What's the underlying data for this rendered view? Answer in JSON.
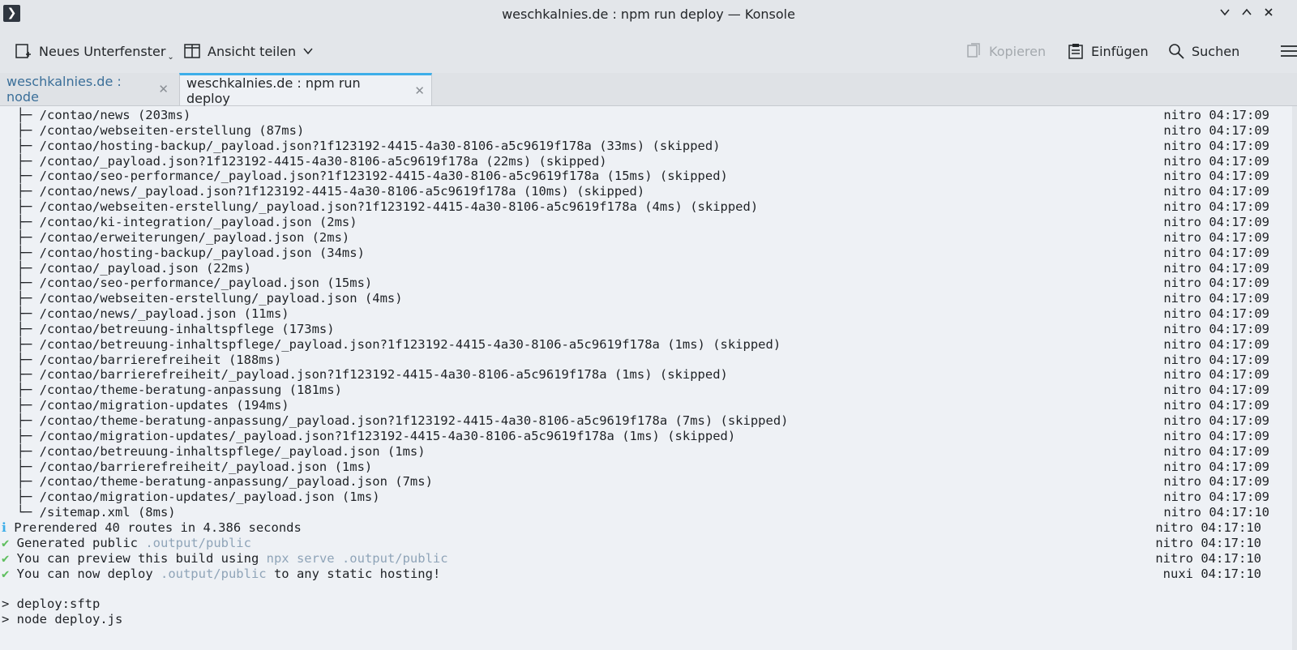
{
  "window": {
    "title": "weschkalnies.de : npm run deploy — Konsole",
    "controls": [
      "minimize",
      "maximize",
      "close"
    ]
  },
  "toolbar": {
    "new_split": "Neues Unterfenster",
    "split_view": "Ansicht teilen",
    "copy": "Kopieren",
    "paste": "Einfügen",
    "search": "Suchen"
  },
  "tabs": [
    {
      "label": "weschkalnies.de : node",
      "active": false
    },
    {
      "label": "weschkalnies.de : npm run deploy",
      "active": true
    }
  ],
  "terminal": {
    "routes": [
      {
        "path": "├─ /contao/news (203ms)",
        "tag": "nitro 04:17:09"
      },
      {
        "path": "├─ /contao/webseiten-erstellung (87ms)",
        "tag": "nitro 04:17:09"
      },
      {
        "path": "├─ /contao/hosting-backup/_payload.json?1f123192-4415-4a30-8106-a5c9619f178a (33ms) (skipped)",
        "tag": "nitro 04:17:09"
      },
      {
        "path": "├─ /contao/_payload.json?1f123192-4415-4a30-8106-a5c9619f178a (22ms) (skipped)",
        "tag": "nitro 04:17:09"
      },
      {
        "path": "├─ /contao/seo-performance/_payload.json?1f123192-4415-4a30-8106-a5c9619f178a (15ms) (skipped)",
        "tag": "nitro 04:17:09"
      },
      {
        "path": "├─ /contao/news/_payload.json?1f123192-4415-4a30-8106-a5c9619f178a (10ms) (skipped)",
        "tag": "nitro 04:17:09"
      },
      {
        "path": "├─ /contao/webseiten-erstellung/_payload.json?1f123192-4415-4a30-8106-a5c9619f178a (4ms) (skipped)",
        "tag": "nitro 04:17:09"
      },
      {
        "path": "├─ /contao/ki-integration/_payload.json (2ms)",
        "tag": "nitro 04:17:09"
      },
      {
        "path": "├─ /contao/erweiterungen/_payload.json (2ms)",
        "tag": "nitro 04:17:09"
      },
      {
        "path": "├─ /contao/hosting-backup/_payload.json (34ms)",
        "tag": "nitro 04:17:09"
      },
      {
        "path": "├─ /contao/_payload.json (22ms)",
        "tag": "nitro 04:17:09"
      },
      {
        "path": "├─ /contao/seo-performance/_payload.json (15ms)",
        "tag": "nitro 04:17:09"
      },
      {
        "path": "├─ /contao/webseiten-erstellung/_payload.json (4ms)",
        "tag": "nitro 04:17:09"
      },
      {
        "path": "├─ /contao/news/_payload.json (11ms)",
        "tag": "nitro 04:17:09"
      },
      {
        "path": "├─ /contao/betreuung-inhaltspflege (173ms)",
        "tag": "nitro 04:17:09"
      },
      {
        "path": "├─ /contao/betreuung-inhaltspflege/_payload.json?1f123192-4415-4a30-8106-a5c9619f178a (1ms) (skipped)",
        "tag": "nitro 04:17:09"
      },
      {
        "path": "├─ /contao/barrierefreiheit (188ms)",
        "tag": "nitro 04:17:09"
      },
      {
        "path": "├─ /contao/barrierefreiheit/_payload.json?1f123192-4415-4a30-8106-a5c9619f178a (1ms) (skipped)",
        "tag": "nitro 04:17:09"
      },
      {
        "path": "├─ /contao/theme-beratung-anpassung (181ms)",
        "tag": "nitro 04:17:09"
      },
      {
        "path": "├─ /contao/migration-updates (194ms)",
        "tag": "nitro 04:17:09"
      },
      {
        "path": "├─ /contao/theme-beratung-anpassung/_payload.json?1f123192-4415-4a30-8106-a5c9619f178a (7ms) (skipped)",
        "tag": "nitro 04:17:09"
      },
      {
        "path": "├─ /contao/migration-updates/_payload.json?1f123192-4415-4a30-8106-a5c9619f178a (1ms) (skipped)",
        "tag": "nitro 04:17:09"
      },
      {
        "path": "├─ /contao/betreuung-inhaltspflege/_payload.json (1ms)",
        "tag": "nitro 04:17:09"
      },
      {
        "path": "├─ /contao/barrierefreiheit/_payload.json (1ms)",
        "tag": "nitro 04:17:09"
      },
      {
        "path": "├─ /contao/theme-beratung-anpassung/_payload.json (7ms)",
        "tag": "nitro 04:17:09"
      },
      {
        "path": "├─ /contao/migration-updates/_payload.json (1ms)",
        "tag": "nitro 04:17:09"
      },
      {
        "path": "└─ /sitemap.xml (8ms)",
        "tag": "nitro 04:17:10"
      }
    ],
    "summary": {
      "prerendered": {
        "mark": "ℹ",
        "text": "Prerendered 40 routes in 4.386 seconds",
        "tag": "nitro 04:17:10"
      },
      "generated": {
        "mark": "✔",
        "text": "Generated public ",
        "highlight": ".output/public",
        "tag": "nitro 04:17:10"
      },
      "preview": {
        "mark": "✔",
        "text": "You can preview this build using ",
        "highlight": "npx serve .output/public",
        "tag": "nitro 04:17:10"
      },
      "deploy": {
        "mark": "✔",
        "text_a": "You can now deploy ",
        "highlight": ".output/public",
        "text_b": " to any static hosting!",
        "tag": "nuxi 04:17:10"
      }
    },
    "prompt_lines": [
      "> deploy:sftp",
      "> node deploy.js"
    ]
  }
}
